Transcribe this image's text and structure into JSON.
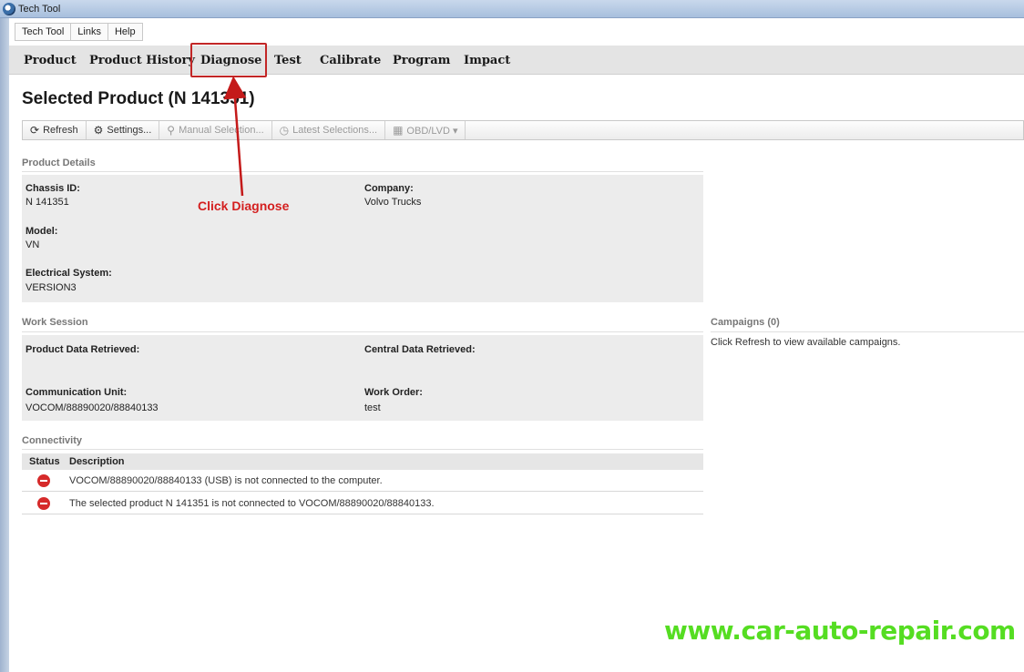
{
  "window": {
    "title": "Tech Tool"
  },
  "menu": [
    "Tech Tool",
    "Links",
    "Help"
  ],
  "tabs": [
    "Product",
    "Product History",
    "Diagnose",
    "Test",
    "Calibrate",
    "Program",
    "Impact"
  ],
  "page_title": "Selected Product (N 141351)",
  "toolbar": {
    "refresh": "Refresh",
    "settings": "Settings...",
    "manual_selection": "Manual Selection...",
    "latest_selections": "Latest Selections...",
    "obd": "OBD/LVD ▾"
  },
  "product_details": {
    "heading": "Product Details",
    "chassis_label": "Chassis ID:",
    "chassis_value": "N 141351",
    "company_label": "Company:",
    "company_value": "Volvo Trucks",
    "model_label": "Model:",
    "model_value": "VN",
    "electrical_label": "Electrical System:",
    "electrical_value": "VERSION3"
  },
  "work_session": {
    "heading": "Work Session",
    "product_data_label": "Product Data Retrieved:",
    "central_data_label": "Central Data Retrieved:",
    "comm_unit_label": "Communication Unit:",
    "comm_unit_value": "VOCOM/88890020/88840133",
    "work_order_label": "Work Order:",
    "work_order_value": "test"
  },
  "campaigns": {
    "heading": "Campaigns  (0)",
    "message": "Click Refresh to view available campaigns."
  },
  "connectivity": {
    "heading": "Connectivity",
    "col_status": "Status",
    "col_description": "Description",
    "rows": [
      "VOCOM/88890020/88840133 (USB) is not connected to the computer.",
      "The selected product N 141351 is not connected to VOCOM/88890020/88840133."
    ]
  },
  "annotation": "Click Diagnose",
  "watermark": "www.car-auto-repair.com",
  "colors": {
    "annotation": "#d41f1f",
    "watermark": "#55dd22",
    "stop": "#d62a2a"
  }
}
